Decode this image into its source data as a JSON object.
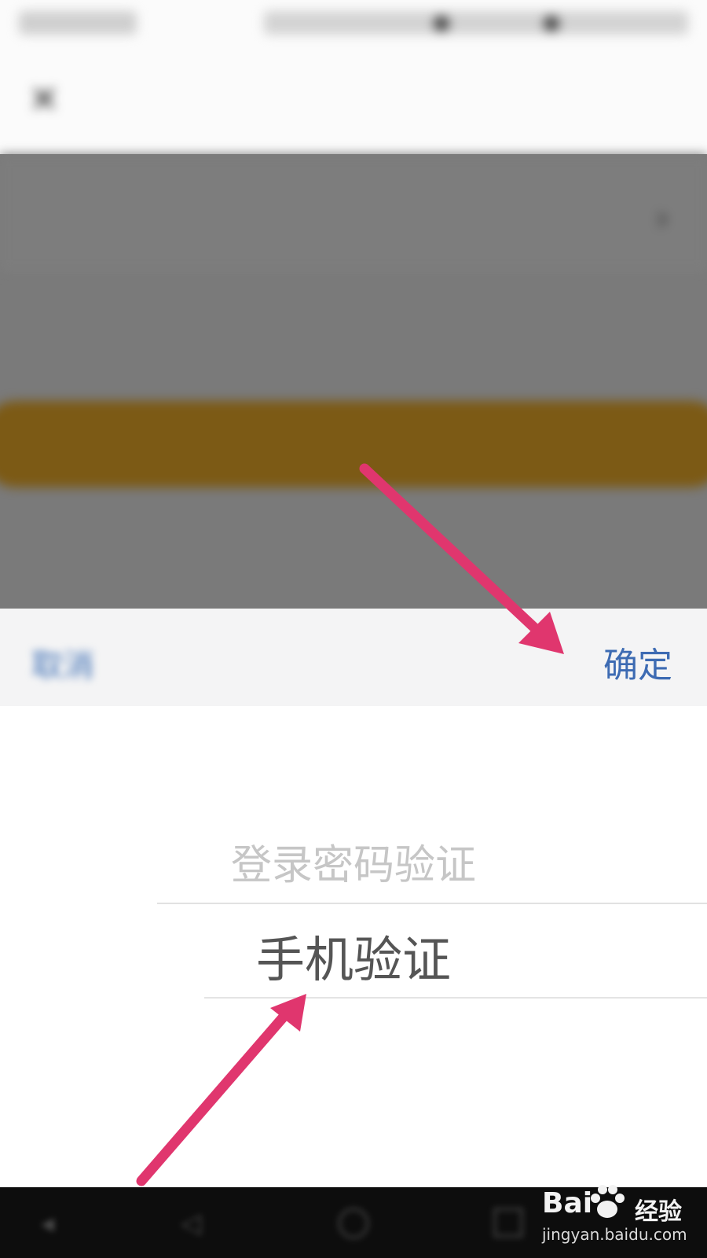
{
  "background_page": {
    "status_bar": {
      "left": "",
      "right": ""
    },
    "title": "",
    "row_title": "",
    "row_hint": "",
    "next_button": ""
  },
  "picker": {
    "cancel_label": "取消",
    "confirm_label": "确定",
    "options": [
      "登录密码验证",
      "手机验证"
    ],
    "selected_value": "手机验证"
  },
  "watermark": {
    "brand": "Bai",
    "brand_suffix": "经验",
    "url": "jingyan.baidu.com"
  },
  "colors": {
    "accent_blue": "#3d6bb3",
    "annotation_arrow": "#e0366e",
    "dim_overlay": "#7a7a7a",
    "button_bg": "#7c5a15"
  },
  "icons": {
    "close": "close-icon",
    "chevron": "chevron-right-icon",
    "paw": "paw-icon"
  }
}
